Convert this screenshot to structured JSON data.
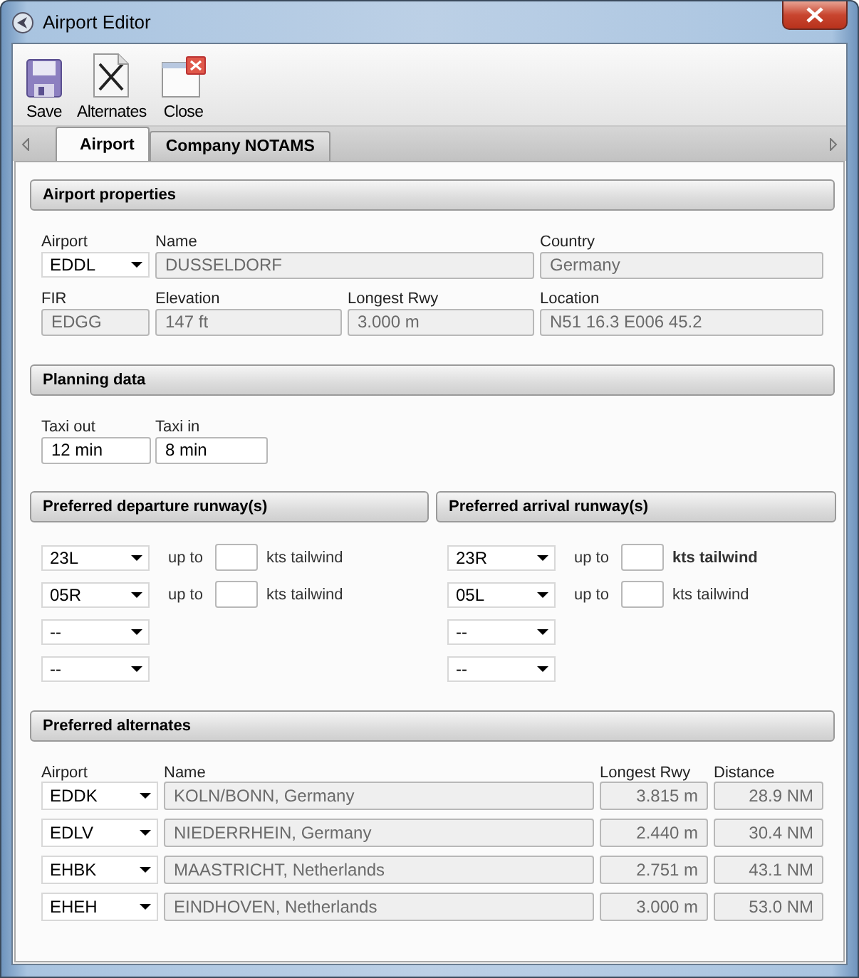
{
  "window": {
    "title": "Airport Editor"
  },
  "toolbar": [
    {
      "kind": "save",
      "label": "Save"
    },
    {
      "kind": "alternates",
      "label": "Alternates"
    },
    {
      "kind": "close",
      "label": "Close"
    }
  ],
  "tabs": [
    {
      "label": "Airport",
      "selected": true
    },
    {
      "label": "Company NOTAMS",
      "selected": false
    }
  ],
  "airport_properties": {
    "title": "Airport properties",
    "airport": {
      "label": "Airport",
      "value": "EDDL"
    },
    "name": {
      "label": "Name",
      "value": "DUSSELDORF"
    },
    "country": {
      "label": "Country",
      "value": "Germany"
    },
    "fir": {
      "label": "FIR",
      "value": "EDGG"
    },
    "elevation": {
      "label": "Elevation",
      "value": "147 ft"
    },
    "longest_rwy": {
      "label": "Longest Rwy",
      "value": "3.000 m"
    },
    "location": {
      "label": "Location",
      "value": "N51 16.3 E006 45.2"
    }
  },
  "planning_data": {
    "title": "Planning data",
    "taxi_out": {
      "label": "Taxi out",
      "value": "12 min"
    },
    "taxi_in": {
      "label": "Taxi in",
      "value": "8 min"
    }
  },
  "runway_groups": [
    {
      "title": "Preferred departure runway(s)",
      "rows": [
        {
          "runway": "23L",
          "up_to": "up to",
          "unit": "kts tailwind",
          "unit_bold": false
        },
        {
          "runway": "05R",
          "up_to": "up to",
          "unit": "kts tailwind",
          "unit_bold": false
        },
        {
          "runway": "--"
        },
        {
          "runway": "--"
        }
      ]
    },
    {
      "title": "Preferred arrival runway(s)",
      "rows": [
        {
          "runway": "23R",
          "up_to": "up to",
          "unit": "kts tailwind",
          "unit_bold": true
        },
        {
          "runway": "05L",
          "up_to": "up to",
          "unit": "kts tailwind",
          "unit_bold": false
        },
        {
          "runway": "--"
        },
        {
          "runway": "--"
        }
      ]
    }
  ],
  "alternates": {
    "title": "Preferred alternates",
    "columns": [
      "Airport",
      "Name",
      "Longest Rwy",
      "Distance"
    ],
    "rows": [
      {
        "airport": "EDDK",
        "name": "KOLN/BONN, Germany",
        "longest_rwy": "3.815 m",
        "distance": "28.9 NM"
      },
      {
        "airport": "EDLV",
        "name": "NIEDERRHEIN, Germany",
        "longest_rwy": "2.440 m",
        "distance": "30.4 NM"
      },
      {
        "airport": "EHBK",
        "name": "MAASTRICHT, Netherlands",
        "longest_rwy": "2.751 m",
        "distance": "43.1 NM"
      },
      {
        "airport": "EHEH",
        "name": "EINDHOVEN, Netherlands",
        "longest_rwy": "3.000 m",
        "distance": "53.0 NM"
      }
    ]
  }
}
